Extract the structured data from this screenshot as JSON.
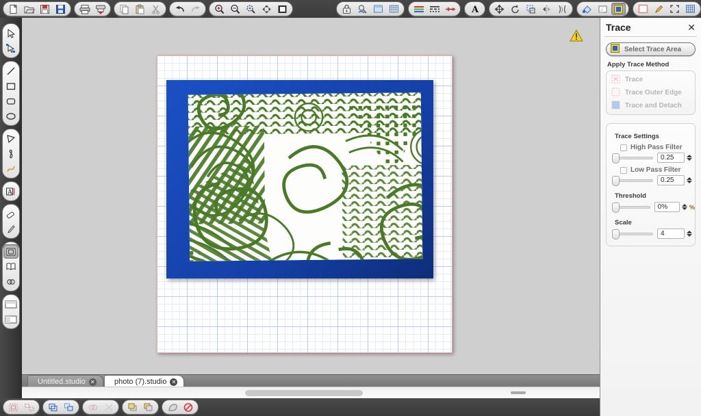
{
  "app": {
    "top_toolbar": {
      "groups": [
        {
          "name": "file",
          "buttons": [
            {
              "icon": "new-document-icon",
              "label": "New"
            },
            {
              "icon": "open-folder-icon",
              "label": "Open"
            },
            {
              "icon": "save-icon",
              "label": "Save"
            },
            {
              "icon": "save-as-icon",
              "label": "Save As"
            }
          ]
        },
        {
          "name": "print",
          "buttons": [
            {
              "icon": "print-icon",
              "label": "Print"
            },
            {
              "icon": "send-to-cutter-icon",
              "label": "Send to Silhouette"
            }
          ]
        },
        {
          "name": "clipboard",
          "buttons": [
            {
              "icon": "copy-icon",
              "label": "Copy"
            },
            {
              "icon": "paste-icon",
              "label": "Paste"
            },
            {
              "icon": "cut-icon",
              "label": "Cut"
            }
          ]
        },
        {
          "name": "history",
          "buttons": [
            {
              "icon": "undo-icon",
              "label": "Undo"
            },
            {
              "icon": "redo-icon",
              "label": "Redo"
            }
          ]
        },
        {
          "name": "zoom",
          "buttons": [
            {
              "icon": "zoom-in-icon",
              "label": "Zoom In"
            },
            {
              "icon": "zoom-out-icon",
              "label": "Zoom Out"
            },
            {
              "icon": "zoom-selection-icon",
              "label": "Zoom to Selection"
            },
            {
              "icon": "fit-to-page-icon",
              "label": "Fit to Page"
            },
            {
              "icon": "fit-to-window-icon",
              "label": "Fit to Window"
            }
          ]
        },
        {
          "name": "page",
          "buttons": [
            {
              "icon": "lock-icon",
              "label": "Cut Settings"
            },
            {
              "icon": "cut-preview-icon",
              "label": "Preview"
            },
            {
              "icon": "page-setup-icon",
              "label": "Page Setup"
            },
            {
              "icon": "registration-marks-icon",
              "label": "Registration Marks"
            }
          ]
        },
        {
          "name": "style",
          "buttons": [
            {
              "icon": "line-color-icon",
              "label": "Line Color"
            },
            {
              "icon": "line-style-icon",
              "label": "Line Style"
            },
            {
              "icon": "line-thickness-icon",
              "label": "Line Thickness"
            }
          ]
        },
        {
          "name": "text",
          "buttons": [
            {
              "icon": "text-style-icon",
              "label": "Text Style"
            }
          ]
        },
        {
          "name": "transform",
          "buttons": [
            {
              "icon": "move-icon",
              "label": "Move"
            },
            {
              "icon": "rotate-icon",
              "label": "Rotate"
            },
            {
              "icon": "scale-icon",
              "label": "Scale"
            },
            {
              "icon": "mirror-icon",
              "label": "Mirror"
            },
            {
              "icon": "align-icon",
              "label": "Align"
            }
          ]
        },
        {
          "name": "media",
          "buttons": [
            {
              "icon": "fill-color-icon",
              "label": "Fill Color"
            },
            {
              "icon": "fill-gradient-icon",
              "label": "Fill Gradient"
            },
            {
              "icon": "trace-icon",
              "label": "Trace",
              "active": true
            }
          ]
        },
        {
          "name": "view",
          "buttons": [
            {
              "icon": "pattern-fill-icon",
              "label": "Pattern Fill"
            },
            {
              "icon": "sketch-pen-icon",
              "label": "Sketch Pen"
            },
            {
              "icon": "crop-icon",
              "label": "Crop"
            },
            {
              "icon": "grid-icon",
              "label": "Grid"
            }
          ]
        }
      ]
    },
    "left_toolbar": {
      "groups": [
        {
          "name": "selection",
          "buttons": [
            {
              "icon": "select-arrow-icon",
              "label": "Select"
            },
            {
              "icon": "edit-points-icon",
              "label": "Edit Points"
            }
          ]
        },
        {
          "name": "shapes",
          "buttons": [
            {
              "icon": "line-tool-icon",
              "label": "Draw a Line"
            },
            {
              "icon": "rectangle-tool-icon",
              "label": "Draw a Rectangle"
            },
            {
              "icon": "rounded-rectangle-tool-icon",
              "label": "Draw a Rounded Rectangle"
            },
            {
              "icon": "ellipse-tool-icon",
              "label": "Draw an Ellipse"
            }
          ]
        },
        {
          "name": "paths",
          "buttons": [
            {
              "icon": "polygon-tool-icon",
              "label": "Draw a Polygon"
            },
            {
              "icon": "curve-tool-icon",
              "label": "Draw a Curve Shape"
            },
            {
              "icon": "freehand-tool-icon",
              "label": "Draw Freehand"
            }
          ]
        },
        {
          "name": "text",
          "buttons": [
            {
              "icon": "text-tool-icon",
              "label": "Draw a Text Box"
            }
          ]
        },
        {
          "name": "edit",
          "buttons": [
            {
              "icon": "eraser-tool-icon",
              "label": "Eraser"
            },
            {
              "icon": "knife-tool-icon",
              "label": "Knife"
            }
          ]
        },
        {
          "name": "panels",
          "buttons": [
            {
              "icon": "trace-panel-icon",
              "label": "Open the Trace Window",
              "active": true
            },
            {
              "icon": "library-icon",
              "label": "Open the Library"
            },
            {
              "icon": "weld-icon",
              "label": "Open the Modify Window"
            }
          ]
        },
        {
          "name": "layout",
          "buttons": [
            {
              "icon": "page-view-icon",
              "label": "Page Setup"
            },
            {
              "icon": "panel-layout-icon",
              "label": "Panel Layout"
            }
          ]
        }
      ]
    },
    "canvas": {
      "warning_icon": "warning-triangle-icon",
      "artboard": {
        "grid": "on",
        "border_color": "#e8a9a9"
      },
      "image": {
        "name": "traced-photo",
        "description": "Photograph of a green zentangle doodle drawing on a blue mat",
        "mat_color": "#1440a8",
        "ink_color": "#4a7a28",
        "paper_color": "#fdfdfb"
      }
    },
    "tabs": [
      {
        "label": "Untitled.studio",
        "active": false,
        "close_icon": "close-icon"
      },
      {
        "label": "photo (7).studio",
        "active": true,
        "close_icon": "close-icon"
      }
    ],
    "bottom_toolbar": {
      "groups": [
        {
          "name": "group",
          "buttons": [
            {
              "icon": "group-icon",
              "label": "Group"
            },
            {
              "icon": "ungroup-icon",
              "label": "Ungroup"
            }
          ]
        },
        {
          "name": "compound",
          "buttons": [
            {
              "icon": "make-compound-path-icon",
              "label": "Make Compound Path"
            },
            {
              "icon": "release-compound-path-icon",
              "label": "Release Compound Path"
            }
          ]
        },
        {
          "name": "weld",
          "buttons": [
            {
              "icon": "weld-shapes-icon",
              "label": "Weld"
            },
            {
              "icon": "detach-lines-icon",
              "label": "Detach Lines"
            }
          ]
        },
        {
          "name": "arrange",
          "buttons": [
            {
              "icon": "bring-to-front-icon",
              "label": "Bring to Front"
            },
            {
              "icon": "send-to-back-icon",
              "label": "Send to Back"
            }
          ]
        },
        {
          "name": "fill",
          "buttons": [
            {
              "icon": "fill-shape-icon",
              "label": "Fill"
            },
            {
              "icon": "no-fill-icon",
              "label": "No Fill"
            }
          ]
        }
      ],
      "color_wheel_icon": "color-wheel-icon"
    },
    "panel": {
      "title": "Trace",
      "close_icon": "close-icon",
      "select_trace_area": {
        "label": "Select Trace Area",
        "icon": "trace-area-icon"
      },
      "apply_trace_method_label": "Apply Trace Method",
      "methods": [
        {
          "label": "Trace",
          "icon": "trace-method-icon",
          "enabled": false
        },
        {
          "label": "Trace Outer Edge",
          "icon": "trace-outer-edge-icon",
          "enabled": false
        },
        {
          "label": "Trace and Detach",
          "icon": "trace-and-detach-icon",
          "enabled": false
        }
      ],
      "settings": {
        "label": "Trace Settings",
        "high_pass_filter": {
          "label": "High Pass Filter",
          "checked": false,
          "value": "0.25",
          "slider_pct": 0
        },
        "low_pass_filter": {
          "label": "Low Pass Filter",
          "checked": false,
          "value": "0.25",
          "slider_pct": 0
        },
        "threshold": {
          "label": "Threshold",
          "value": "0%",
          "unit": "%",
          "slider_pct": 0
        },
        "scale": {
          "label": "Scale",
          "value": "4",
          "slider_pct": 0
        }
      }
    },
    "scrollbars": {
      "vertical": {
        "name": "vertical-scrollbar"
      },
      "horizontal": {
        "name": "horizontal-scrollbar"
      }
    }
  }
}
